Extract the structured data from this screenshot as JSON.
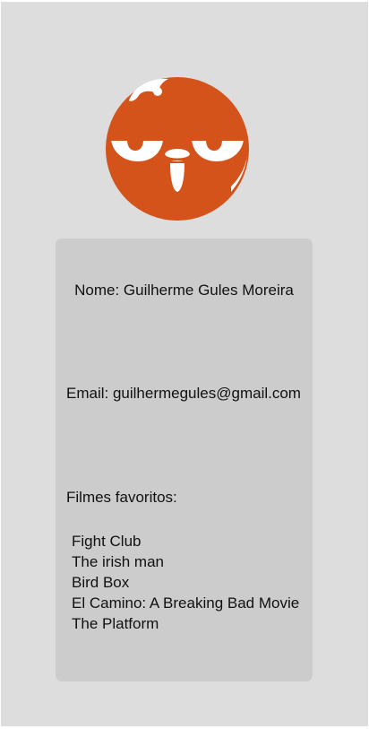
{
  "profile": {
    "name_line": "Nome: Guilherme Gules Moreira",
    "email_line": "Email: guilhermegules@gmail.com",
    "favorites_title": "Filmes favoritos:",
    "favorites": [
      "Fight Club",
      "The irish man",
      "Bird Box",
      "El Camino: A Breaking Bad Movie",
      "The Platform"
    ]
  },
  "colors": {
    "background": "#dddddd",
    "card": "#cccccc",
    "avatar": "#d4531b",
    "avatar_features": "#ffffff"
  },
  "avatar": {
    "icon": "grumpy-bird-avatar-icon"
  }
}
